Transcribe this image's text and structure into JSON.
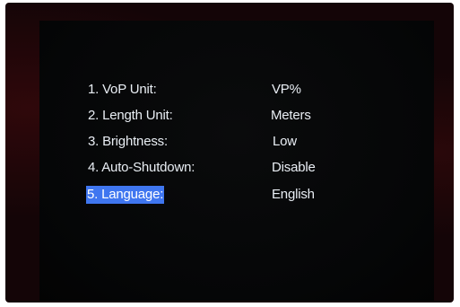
{
  "menu": {
    "items": [
      {
        "label": "1. VoP Unit:",
        "value": "VP%",
        "selected": false
      },
      {
        "label": "2. Length Unit:",
        "value": "Meters",
        "selected": false
      },
      {
        "label": "3. Brightness:",
        "value": "Low",
        "selected": false
      },
      {
        "label": "4. Auto-Shutdown:",
        "value": "Disable",
        "selected": false
      },
      {
        "label": "5. Language:",
        "value": "English",
        "selected": true
      }
    ]
  },
  "colors": {
    "highlight": "#3f76f0",
    "text": "#e9eef4",
    "screen_bg": "#050607",
    "bezel": "#140507"
  }
}
